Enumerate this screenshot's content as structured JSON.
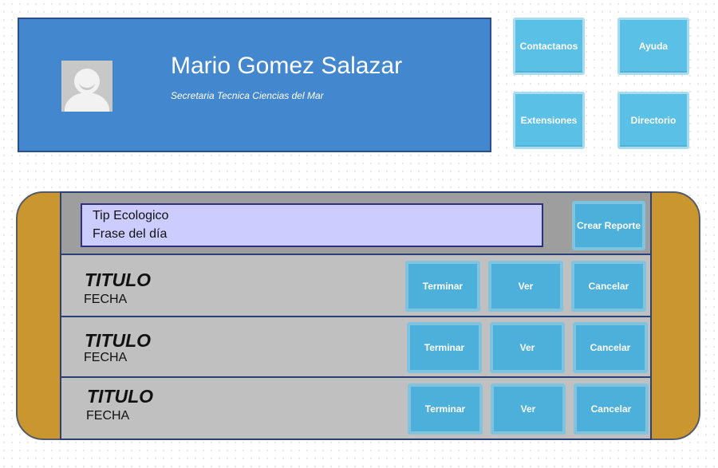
{
  "profile": {
    "name": "Mario Gomez Salazar",
    "role": "Secretaria Tecnica Ciencias del Mar"
  },
  "shortcuts": {
    "contact": "Contactanos",
    "help": "Ayuda",
    "extensions": "Extensiones",
    "directory": "Directorio"
  },
  "tip": {
    "title": "Tip Ecologico",
    "phrase": "Frase del día",
    "create_report": "Crear Reporte"
  },
  "tasks": [
    {
      "title": "TITULO",
      "date": "FECHA",
      "finish": "Terminar",
      "view": "Ver",
      "cancel": "Cancelar"
    },
    {
      "title": "TITULO",
      "date": "FECHA",
      "finish": "Terminar",
      "view": "Ver",
      "cancel": "Cancelar"
    },
    {
      "title": "TITULO",
      "date": "FECHA",
      "finish": "Terminar",
      "view": "Ver",
      "cancel": "Cancelar"
    }
  ],
  "colors": {
    "profile_bg": "#4387cf",
    "tile_bg": "#5bc0e6",
    "button_bg": "#4cb0db",
    "panel_frame": "#c9962f",
    "tip_bg": "#ccccff"
  },
  "icons": {
    "avatar": "user-avatar-icon"
  }
}
